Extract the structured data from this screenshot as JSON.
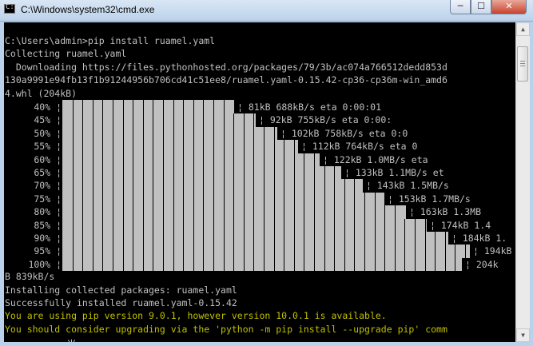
{
  "window": {
    "title": "C:\\Windows\\system32\\cmd.exe",
    "min_label": "─",
    "max_label": "☐",
    "close_label": "✕",
    "icon_text": "C:\\"
  },
  "console": {
    "lines_top": [
      "C:\\Users\\admin>pip install ruamel.yaml",
      "Collecting ruamel.yaml",
      "  Downloading https://files.pythonhosted.org/packages/79/3b/ac074a766512dedd853d",
      "130a9991e94fb13f1b91244956b706cd41c51ee8/ruamel.yaml-0.15.42-cp36-cp36m-win_amd6",
      "4.whl (204kB)"
    ],
    "progress": [
      {
        "label": "40% ¦",
        "fraction": 0.4,
        "tail": "¦ 81kB 688kB/s eta 0:00:01"
      },
      {
        "label": "45% ¦",
        "fraction": 0.45,
        "tail": "¦ 92kB 755kB/s eta 0:00:"
      },
      {
        "label": "50% ¦",
        "fraction": 0.5,
        "tail": "¦ 102kB 758kB/s eta 0:0"
      },
      {
        "label": "55% ¦",
        "fraction": 0.55,
        "tail": "¦ 112kB 764kB/s eta 0"
      },
      {
        "label": "60% ¦",
        "fraction": 0.6,
        "tail": "¦ 122kB 1.0MB/s eta"
      },
      {
        "label": "65% ¦",
        "fraction": 0.65,
        "tail": "¦ 133kB 1.1MB/s et"
      },
      {
        "label": "70% ¦",
        "fraction": 0.7,
        "tail": "¦ 143kB 1.5MB/s"
      },
      {
        "label": "75% ¦",
        "fraction": 0.75,
        "tail": "¦ 153kB 1.7MB/s"
      },
      {
        "label": "80% ¦",
        "fraction": 0.8,
        "tail": "¦ 163kB 1.3MB"
      },
      {
        "label": "85% ¦",
        "fraction": 0.85,
        "tail": "¦ 174kB 1.4"
      },
      {
        "label": "90% ¦",
        "fraction": 0.9,
        "tail": "¦ 184kB 1."
      },
      {
        "label": "95% ¦",
        "fraction": 0.95,
        "tail": "¦ 194kB"
      },
      {
        "label": "100% ¦",
        "fraction": 1.0,
        "tail": "¦ 204k"
      }
    ],
    "lines_bottom": [
      {
        "text": "B 839kB/s",
        "color": "gray"
      },
      {
        "text": "Installing collected packages: ruamel.yaml",
        "color": "gray"
      },
      {
        "text": "Successfully installed ruamel.yaml-0.15.42",
        "color": "gray"
      },
      {
        "text": "You are using pip version 9.0.1, however version 10.0.1 is available.",
        "color": "yellow"
      },
      {
        "text": "You should consider upgrading via the 'python -m pip install --upgrade pip' comm",
        "color": "yellow"
      }
    ],
    "prompt_glyph": "半:",
    "text_color": "#c0c0c0",
    "warning_color": "#c0c000",
    "background": "#000000"
  },
  "scrollbar": {
    "up_label": "▲",
    "down_label": "▼"
  }
}
